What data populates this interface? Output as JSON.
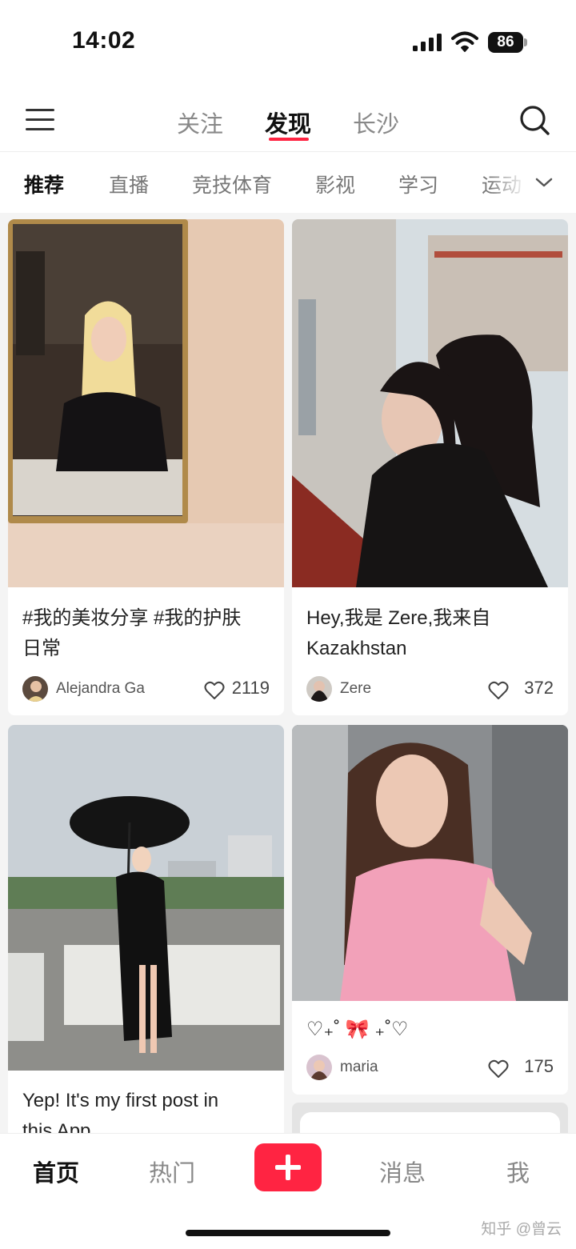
{
  "status_bar": {
    "time": "14:02",
    "battery": "86"
  },
  "top_nav": {
    "tabs": [
      {
        "label": "关注"
      },
      {
        "label": "发现"
      },
      {
        "label": "长沙"
      }
    ]
  },
  "categories": [
    "推荐",
    "直播",
    "竞技体育",
    "影视",
    "学习",
    "运动"
  ],
  "feed": {
    "cards": [
      {
        "title_line1": "#我的美妆分享 #我的护肤",
        "title_line2": "日常",
        "author": "Alejandra Ga",
        "likes": "2119"
      },
      {
        "title_line1": "Hey,我是 Zere,我来自",
        "title_line2": " Kazakhstan",
        "author": "Zere",
        "likes": "372"
      },
      {
        "title_line1": "Yep! It's my first post in",
        "title_line2": "this App",
        "author": "",
        "likes": ""
      },
      {
        "title_line1": "♡₊˚ 🎀 ₊˚♡",
        "title_line2": "",
        "author": "maria",
        "likes": "175"
      }
    ]
  },
  "bottom_bar": {
    "tabs": [
      {
        "label": "首页"
      },
      {
        "label": "热门"
      },
      {
        "label": "消息"
      },
      {
        "label": "我"
      }
    ],
    "watermark": "知乎 @曾云"
  },
  "colors": {
    "accent": "#ff2442",
    "background": "#f4f4f4"
  }
}
